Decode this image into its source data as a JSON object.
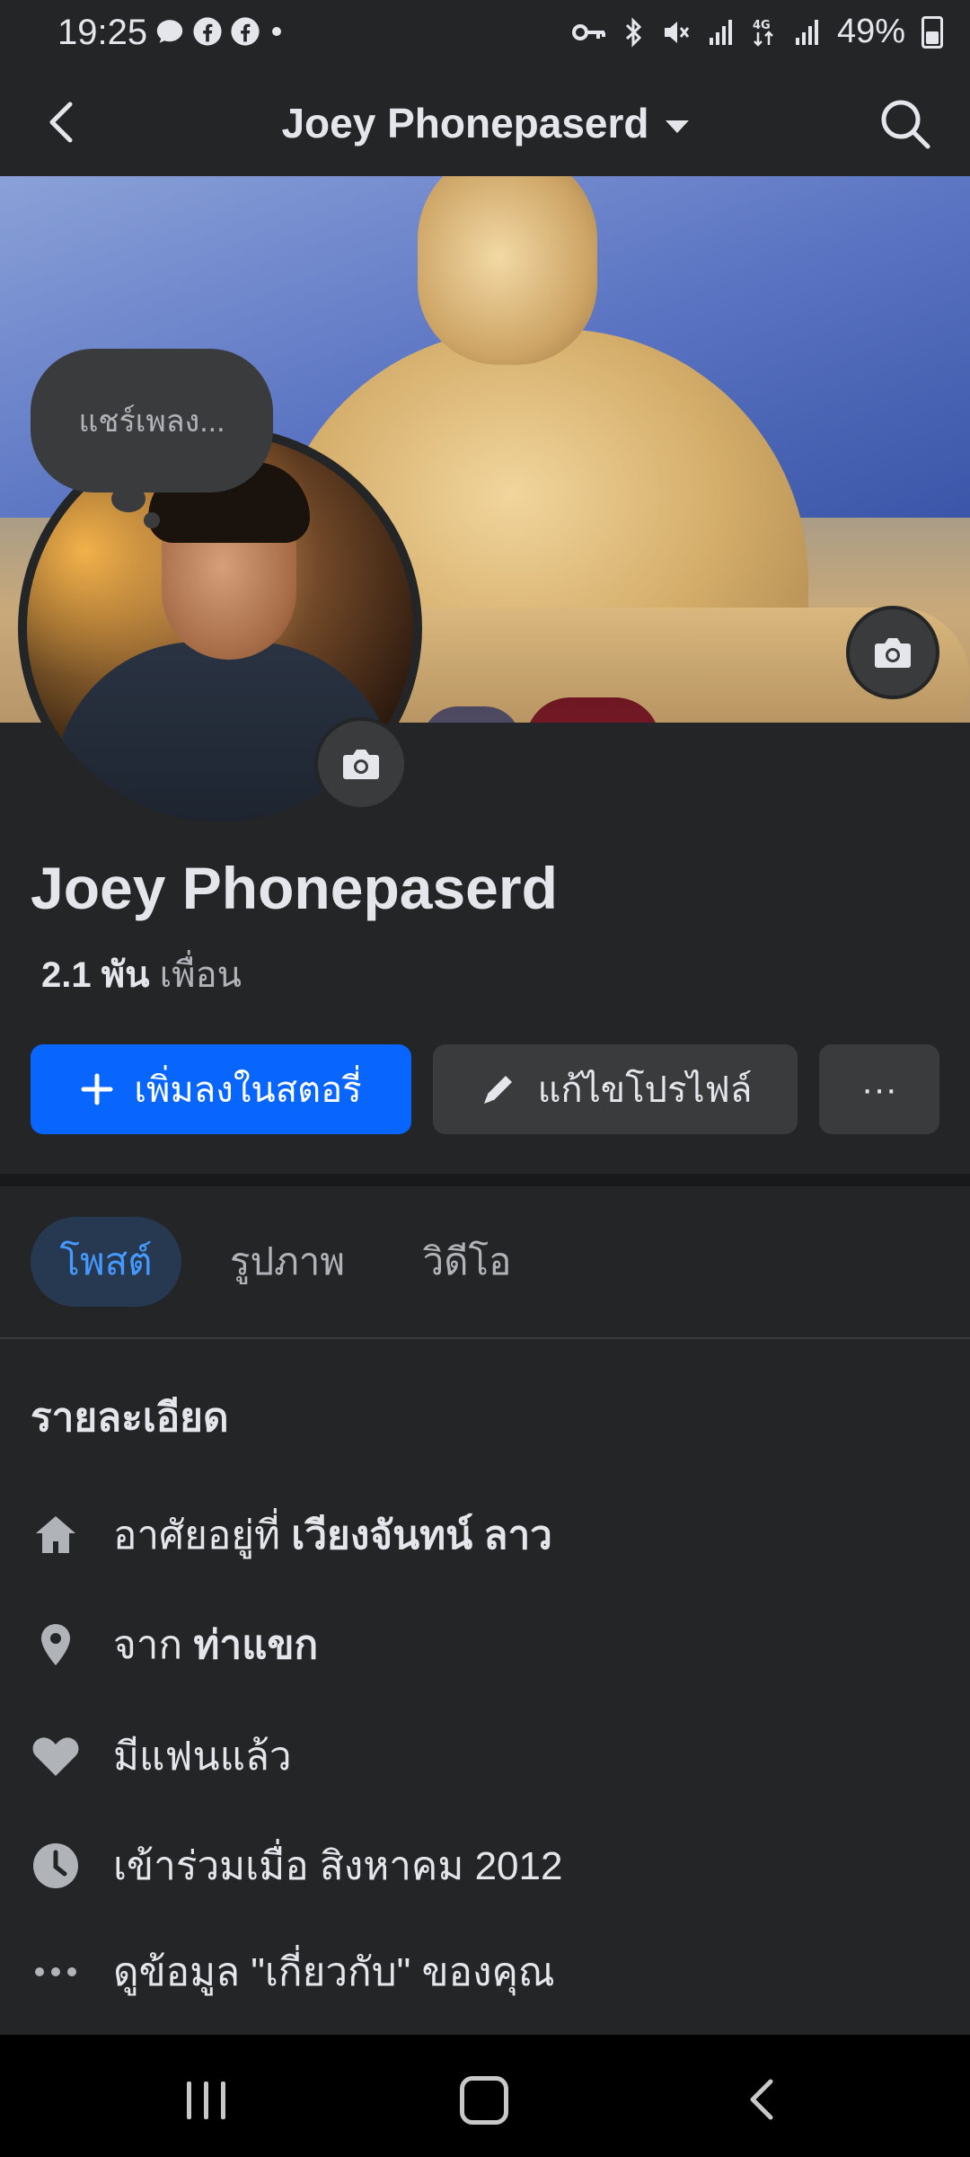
{
  "status_bar": {
    "time": "19:25",
    "battery": "49%",
    "icons_left": [
      "chat-bubble-icon",
      "facebook-icon",
      "facebook-icon",
      "dot-icon"
    ],
    "icons_right": [
      "key-icon",
      "bluetooth-icon",
      "mute-icon",
      "signal-icon",
      "4g-icon",
      "signal-icon",
      "battery-icon"
    ]
  },
  "header": {
    "title": "Joey Phonepaserd"
  },
  "note": {
    "text": "แชร์เพลง..."
  },
  "profile": {
    "name": "Joey Phonepaserd",
    "friends_count": "2.1 พัน",
    "friends_label": "เพื่อน"
  },
  "actions": {
    "add_story": "เพิ่มลงในสตอรี่",
    "edit_profile": "แก้ไขโปรไฟล์",
    "more": "···"
  },
  "tabs": [
    {
      "label": "โพสต์",
      "active": true
    },
    {
      "label": "รูปภาพ",
      "active": false
    },
    {
      "label": "วิดีโอ",
      "active": false
    }
  ],
  "details": {
    "title": "รายละเอียด",
    "items": [
      {
        "icon": "home-icon",
        "prefix": "อาศัยอยู่ที่ ",
        "bold": "เวียงจันทน์ ลาว"
      },
      {
        "icon": "location-pin-icon",
        "prefix": "จาก ",
        "bold": "ท่าแขก"
      },
      {
        "icon": "heart-icon",
        "prefix": "มีแฟนแล้ว",
        "bold": ""
      },
      {
        "icon": "clock-icon",
        "prefix": "เข้าร่วมเมื่อ สิงหาคม 2012",
        "bold": ""
      },
      {
        "icon": "more-dots-icon",
        "prefix": "ดูข้อมูล \"เกี่ยวกับ\" ของคุณ",
        "bold": ""
      }
    ]
  },
  "colors": {
    "background": "#242526",
    "primary": "#0866ff",
    "secondary_button": "#3a3b3c",
    "active_tab_bg": "#263951",
    "active_tab_text": "#4599ff"
  }
}
